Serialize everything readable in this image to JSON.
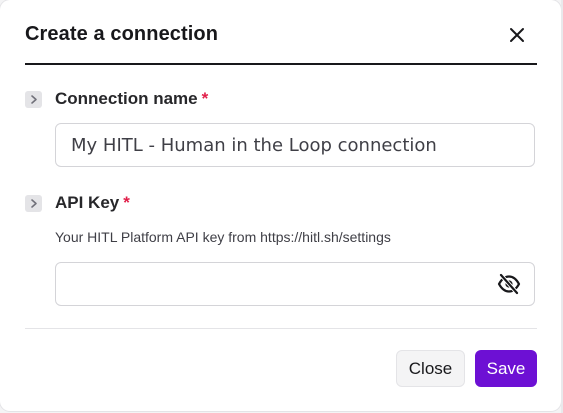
{
  "dialog": {
    "title": "Create a connection"
  },
  "form": {
    "connection_name": {
      "label": "Connection name",
      "required_mark": "*",
      "value": "My HITL - Human in the Loop connection"
    },
    "api_key": {
      "label": "API Key",
      "required_mark": "*",
      "hint": "Your HITL Platform API key from https://hitl.sh/settings",
      "value": ""
    }
  },
  "footer": {
    "close_label": "Close",
    "save_label": "Save"
  },
  "icons": {
    "close": "close-icon",
    "expand": "chevron-right-icon",
    "visibility": "eye-off-icon"
  },
  "colors": {
    "primary": "#6d10d4",
    "required": "#e11d48"
  }
}
